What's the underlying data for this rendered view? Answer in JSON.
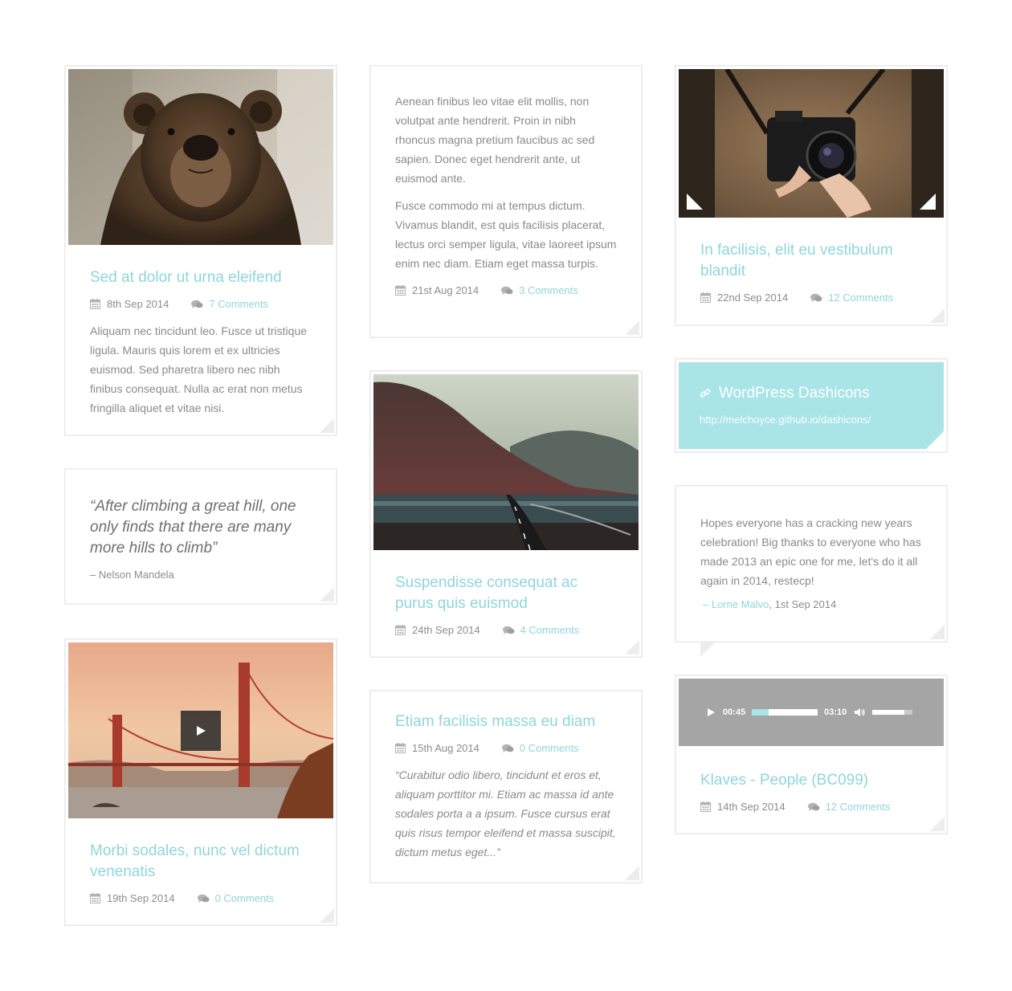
{
  "colors": {
    "accent": "#8fd6dc",
    "link_bg": "#a9e4e6",
    "text": "#8a8a8a",
    "border": "#e9e9e9"
  },
  "cards": {
    "bear": {
      "image_icon": "bear-photo",
      "title": "Sed at dolor ut urna eleifend",
      "date": "8th Sep 2014",
      "comments": "7 Comments",
      "excerpt": "Aliquam nec tincidunt leo. Fusce ut tristique ligula. Mauris quis lorem et ex ultricies euismod. Sed pharetra libero nec nibh finibus consequat. Nulla ac erat non metus fringilla aliquet et vitae nisi."
    },
    "text_post": {
      "para1": "Aenean finibus leo vitae elit mollis, non volutpat ante hendrerit. Proin in nibh rhoncus magna pretium faucibus ac sed sapien. Donec eget hendrerit ante, ut euismod ante.",
      "para2": "Fusce commodo mi at tempus dictum. Vivamus blandit, est quis facilisis placerat, lectus orci semper ligula, vitae laoreet ipsum enim nec diam. Etiam eget massa turpis.",
      "date": "21st Aug 2014",
      "comments": "3 Comments"
    },
    "camera": {
      "image_icon": "camera-photo",
      "title": "In facilisis, elit eu vestibulum blandit",
      "date": "22nd Sep 2014",
      "comments": "12 Comments"
    },
    "quote": {
      "text": "“After climbing a great hill, one only finds that there are many more hills to climb”",
      "author": "– Nelson Mandela"
    },
    "road": {
      "image_icon": "mountain-road-photo",
      "title": "Suspendisse consequat ac purus quis euismod",
      "date": "24th Sep 2014",
      "comments": "4 Comments"
    },
    "link": {
      "title": "WordPress Dashicons",
      "url": "http://melchoyce.github.io/dashicons/"
    },
    "status": {
      "text": "Hopes everyone has a cracking new years celebration! Big thanks to everyone who has made 2013 an epic one for me, let's do it all again in 2014, restecp!",
      "dash": "– ",
      "author": "Lorne Malvo",
      "date": ", 1st Sep 2014"
    },
    "bridge": {
      "image_icon": "golden-gate-photo",
      "title": "Morbi sodales, nunc vel dictum venenatis",
      "date": "19th Sep 2014",
      "comments": "0 Comments"
    },
    "etiam": {
      "title": "Etiam facilisis massa eu diam",
      "date": "15th Aug 2014",
      "comments": "0 Comments",
      "quote": "“Curabitur odio libero, tincidunt et eros et, aliquam porttitor mi. Etiam ac massa id ante sodales porta a a ipsum. Fusce cursus erat quis risus tempor eleifend et massa suscipit, dictum metus eget...”"
    },
    "audio": {
      "current": "00:45",
      "duration": "03:10",
      "progress": 0.25,
      "volume": 0.8,
      "title": "Klaves - People (BC099)",
      "date": "14th Sep 2014",
      "comments": "12 Comments"
    }
  }
}
